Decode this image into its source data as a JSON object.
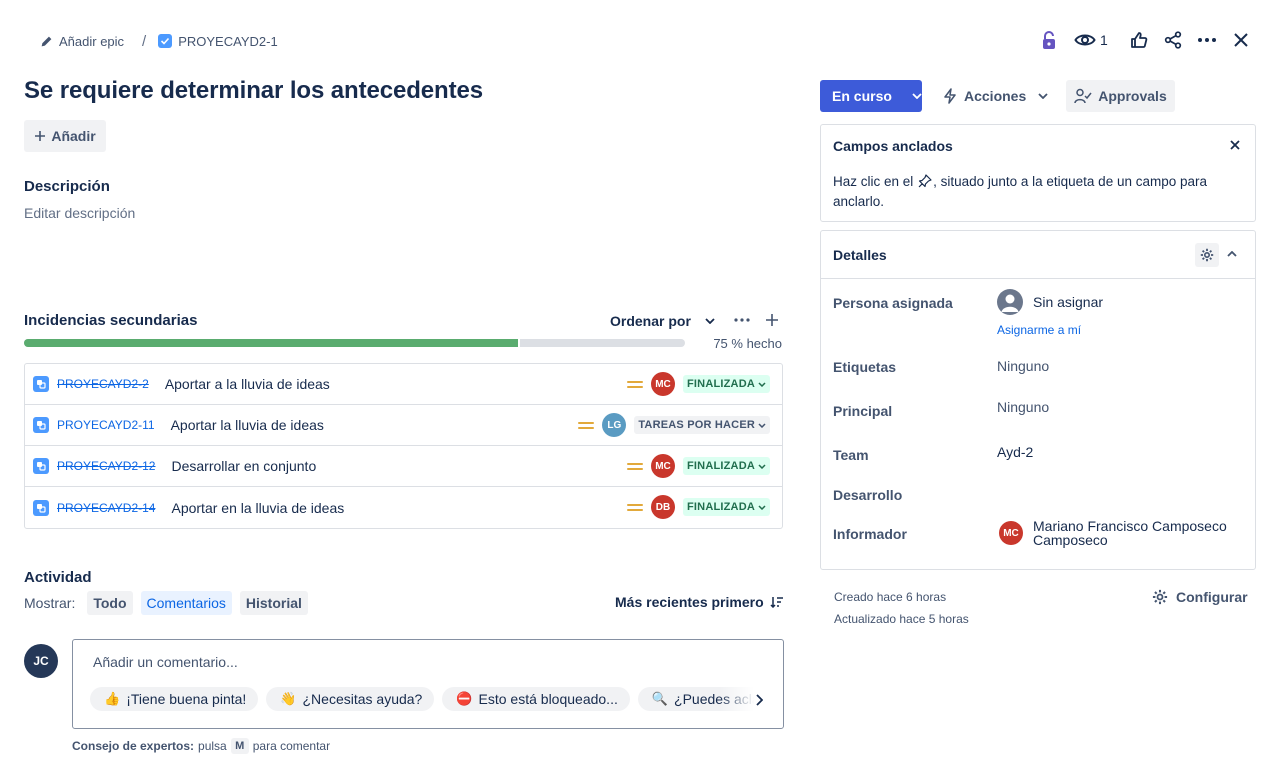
{
  "breadcrumb": {
    "add_epic": "Añadir epic",
    "separator": "/",
    "issue_key": "PROYECAYD2-1"
  },
  "header": {
    "watchers_count": "1"
  },
  "issue": {
    "title": "Se requiere determinar los antecedentes",
    "add_label": "Añadir",
    "description_heading": "Descripción",
    "description_placeholder": "Editar descripción"
  },
  "child_issues": {
    "heading": "Incidencias secundarias",
    "sort_label": "Ordenar por",
    "progress_percent": 75,
    "progress_text": "75 % hecho",
    "items": [
      {
        "key": "PROYECAYD2-2",
        "summary": "Aportar a la lluvia de ideas",
        "done": true,
        "assignee_initials": "MC",
        "avatar_color": "#c9372c",
        "status": "FINALIZADA"
      },
      {
        "key": "PROYECAYD2-11",
        "summary": "Aportar la lluvia de ideas",
        "done": false,
        "assignee_initials": "LG",
        "avatar_color": "#5a9bc2",
        "status": "TAREAS POR HACER"
      },
      {
        "key": "PROYECAYD2-12",
        "summary": "Desarrollar en conjunto",
        "done": true,
        "assignee_initials": "MC",
        "avatar_color": "#c9372c",
        "status": "FINALIZADA"
      },
      {
        "key": "PROYECAYD2-14",
        "summary": "Aportar en la lluvia de ideas",
        "done": true,
        "assignee_initials": "DB",
        "avatar_color": "#c9372c",
        "status": "FINALIZADA"
      }
    ]
  },
  "activity": {
    "heading": "Actividad",
    "show_label": "Mostrar:",
    "filters": [
      "Todo",
      "Comentarios",
      "Historial"
    ],
    "selected_filter": "Comentarios",
    "sort_label": "Más recientes primero",
    "user_initials": "JC",
    "comment_placeholder": "Añadir un comentario...",
    "quick_replies": [
      {
        "emoji": "👍",
        "text": "¡Tiene buena pinta!"
      },
      {
        "emoji": "👋",
        "text": "¿Necesitas ayuda?"
      },
      {
        "emoji": "⛔",
        "text": "Esto está bloqueado..."
      },
      {
        "emoji": "🔍",
        "text": "¿Puedes aclarar...?"
      }
    ],
    "tip_bold": "Consejo de expertos:",
    "tip_press": "pulsa",
    "tip_key": "M",
    "tip_rest": "para comentar"
  },
  "actions": {
    "status_label": "En curso",
    "status_color": "#3d5bd9",
    "actions_label": "Acciones",
    "approvals_label": "Approvals"
  },
  "pinned_fields": {
    "title": "Campos anclados",
    "text_before": "Haz clic en el",
    "text_after": ", situado junto a la etiqueta de un campo para",
    "text_line2": "anclarlo."
  },
  "details": {
    "heading": "Detalles",
    "assignee_label": "Persona asignada",
    "assignee_value": "Sin asignar",
    "assign_me": "Asignarme a mí",
    "labels_label": "Etiquetas",
    "labels_value": "Ninguno",
    "parent_label": "Principal",
    "parent_value": "Ninguno",
    "team_label": "Team",
    "team_value": "Ayd-2",
    "development_label": "Desarrollo",
    "reporter_label": "Informador",
    "reporter_initials": "MC",
    "reporter_line1": "Mariano Francisco Camposeco",
    "reporter_line2": "Camposeco"
  },
  "footer": {
    "created": "Creado hace 6 horas",
    "updated": "Actualizado hace 5 horas",
    "configure": "Configurar"
  }
}
